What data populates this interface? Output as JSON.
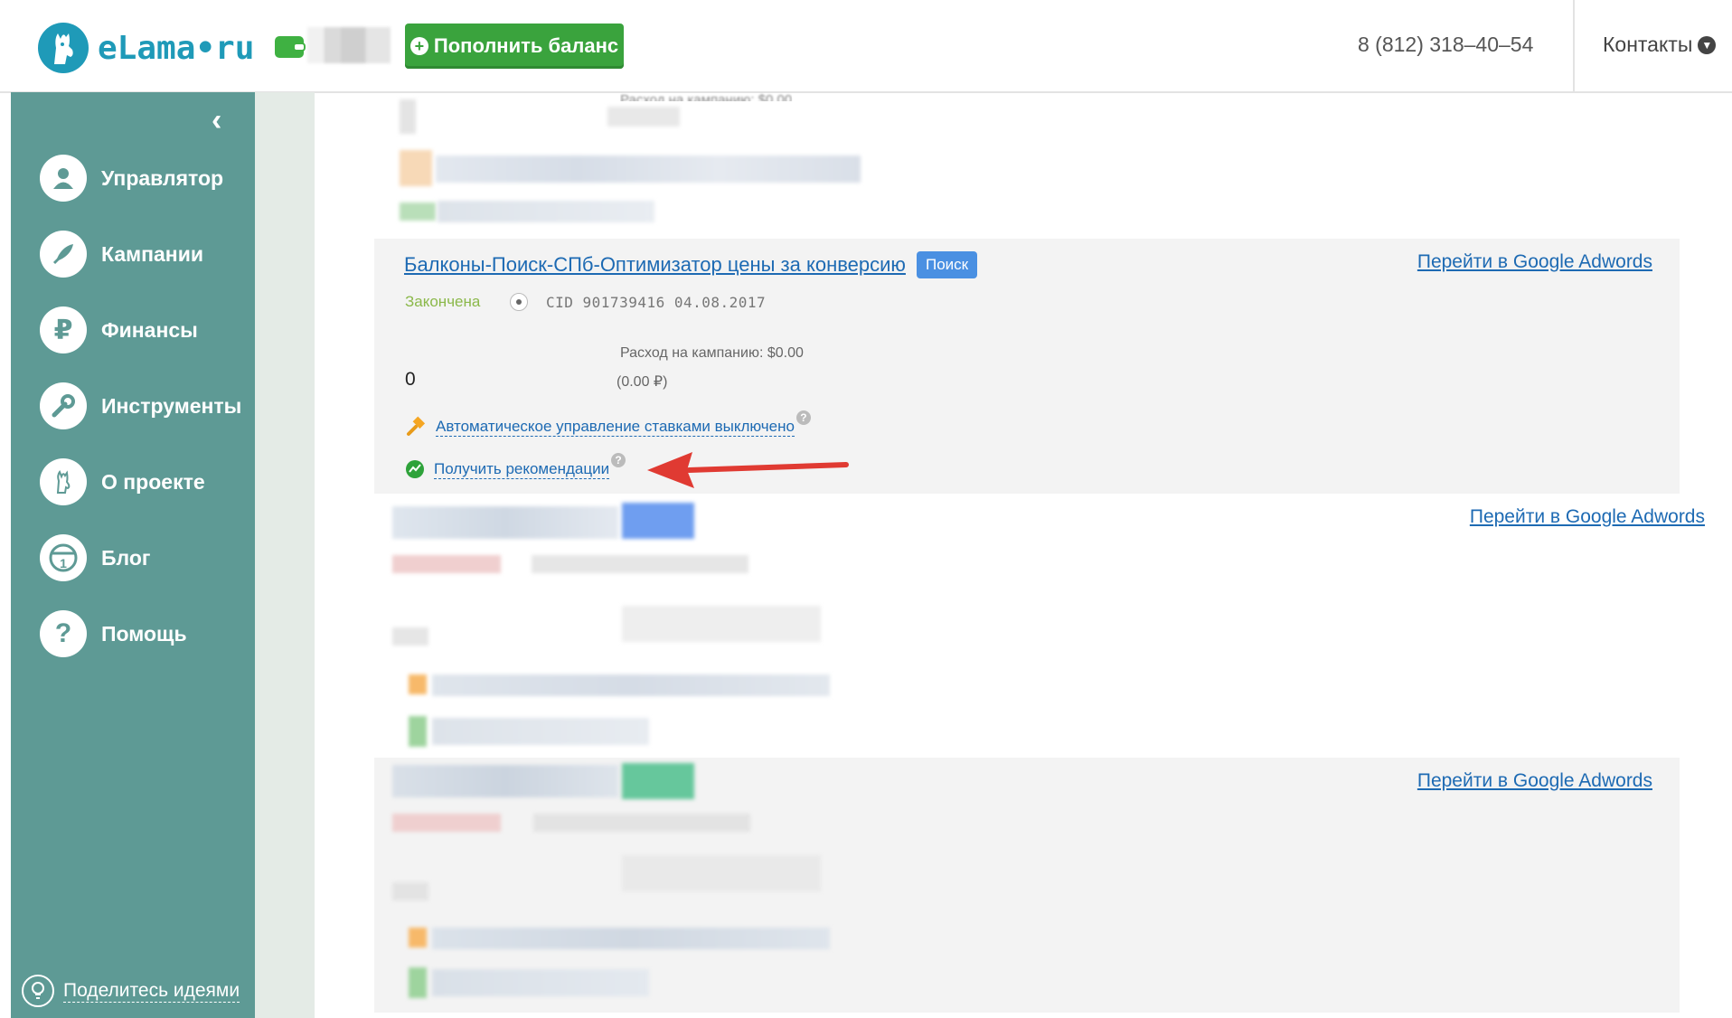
{
  "header": {
    "logo_text": "eLama•ru",
    "topup_label": "Пополнить баланс",
    "phone": "8 (812) 318–40–54",
    "contacts_label": "Контакты"
  },
  "sidebar": {
    "items": [
      {
        "label": "Управлятор",
        "icon": "user-icon"
      },
      {
        "label": "Кампании",
        "icon": "rocket-icon"
      },
      {
        "label": "Финансы",
        "icon": "ruble-icon"
      },
      {
        "label": "Инструменты",
        "icon": "wrench-icon"
      },
      {
        "label": "О проекте",
        "icon": "llama-icon"
      },
      {
        "label": "Блог",
        "icon": "blog-icon"
      },
      {
        "label": "Помощь",
        "icon": "question-icon"
      }
    ],
    "ideas_label": "Поделитесь идеями"
  },
  "campaign": {
    "title": "Балконы-Поиск-СПб-Оптимизатор цены за конверсию",
    "badge": "Поиск",
    "status": "Закончена",
    "cid": "CID  901739416   04.08.2017",
    "spend": "Расход на кампанию: $0.00",
    "spend_rub": "(0.00 ₽)",
    "value": "0",
    "bid_link": "Автоматическое управление ставками выключено",
    "rec_link": "Получить рекомендации",
    "help": "?"
  },
  "partial_text": "Расход на кампанию: $0.00",
  "adwords_link": "Перейти в Google Adwords",
  "colors": {
    "sidebar": "#5e9a95",
    "accent_green": "#3aa33d",
    "link": "#1d6ab3",
    "arrow": "#e03a32"
  }
}
